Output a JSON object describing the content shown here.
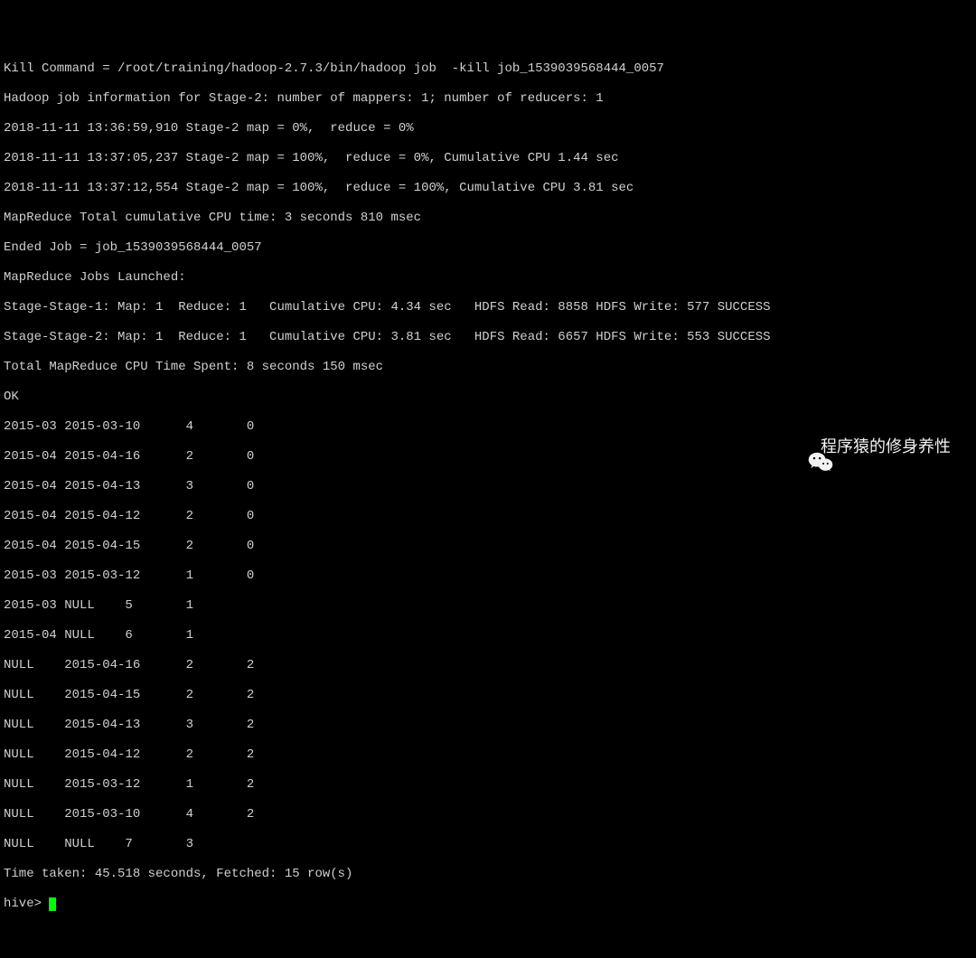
{
  "lines": {
    "l0": "Kill Command = /root/training/hadoop-2.7.3/bin/hadoop job  -kill job_1539039568444_0057",
    "l1": "Hadoop job information for Stage-2: number of mappers: 1; number of reducers: 1",
    "l2": "2018-11-11 13:36:59,910 Stage-2 map = 0%,  reduce = 0%",
    "l3": "2018-11-11 13:37:05,237 Stage-2 map = 100%,  reduce = 0%, Cumulative CPU 1.44 sec",
    "l4": "2018-11-11 13:37:12,554 Stage-2 map = 100%,  reduce = 100%, Cumulative CPU 3.81 sec",
    "l5": "MapReduce Total cumulative CPU time: 3 seconds 810 msec",
    "l6": "Ended Job = job_1539039568444_0057",
    "l7": "MapReduce Jobs Launched:",
    "l8": "Stage-Stage-1: Map: 1  Reduce: 1   Cumulative CPU: 4.34 sec   HDFS Read: 8858 HDFS Write: 577 SUCCESS",
    "l9": "Stage-Stage-2: Map: 1  Reduce: 1   Cumulative CPU: 3.81 sec   HDFS Read: 6657 HDFS Write: 553 SUCCESS",
    "l10": "Total MapReduce CPU Time Spent: 8 seconds 150 msec",
    "l11": "OK",
    "l12": "2015-03 2015-03-10      4       0",
    "l13": "2015-04 2015-04-16      2       0",
    "l14": "2015-04 2015-04-13      3       0",
    "l15": "2015-04 2015-04-12      2       0",
    "l16": "2015-04 2015-04-15      2       0",
    "l17": "2015-03 2015-03-12      1       0",
    "l18": "2015-03 NULL    5       1",
    "l19": "2015-04 NULL    6       1",
    "l20": "NULL    2015-04-16      2       2",
    "l21": "NULL    2015-04-15      2       2",
    "l22": "NULL    2015-04-13      3       2",
    "l23": "NULL    2015-04-12      2       2",
    "l24": "NULL    2015-03-12      1       2",
    "l25": "NULL    2015-03-10      4       2",
    "l26": "NULL    NULL    7       3",
    "l27": "Time taken: 45.518 seconds, Fetched: 15 row(s)",
    "prompt": "hive> "
  },
  "watermark": {
    "text": "程序猿的修身养性"
  }
}
